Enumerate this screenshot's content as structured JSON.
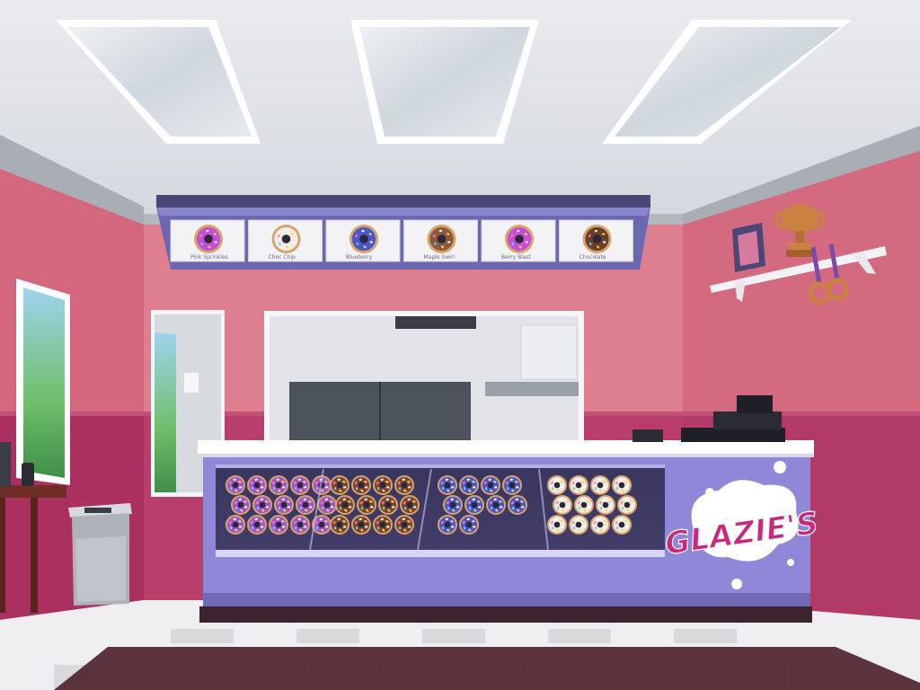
{
  "game": {
    "shop_name": "GLAZIE'S",
    "menu_board": {
      "items": [
        {
          "icon": "donut-pink-sprinkles-icon",
          "caption": "Pink Sprinkles",
          "frosting": "#c44fd6",
          "sprinkles": true
        },
        {
          "icon": "donut-chocolate-chip-icon",
          "caption": "Choc Chip",
          "frosting": "#f1ede6",
          "sprinkles": true
        },
        {
          "icon": "donut-blueberry-icon",
          "caption": "Blueberry",
          "frosting": "#4a56c9",
          "sprinkles": true
        },
        {
          "icon": "donut-maple-icon",
          "caption": "Maple Swirl",
          "frosting": "#8b5a3e",
          "sprinkles": true
        },
        {
          "icon": "donut-berry-icon",
          "caption": "Berry Blast",
          "frosting": "#c44fd6",
          "sprinkles": true
        },
        {
          "icon": "donut-chocolate-icon",
          "caption": "Chocolate",
          "frosting": "#6b3e2a",
          "sprinkles": true
        }
      ]
    },
    "display_case": {
      "sections": [
        {
          "name": "purple-glazed",
          "frosting": "#9e55cc",
          "count": 15
        },
        {
          "name": "chocolate-drizzle",
          "frosting": "#7a4630",
          "count": 12
        },
        {
          "name": "blue-glazed",
          "frosting": "#4b57c9",
          "count": 10
        },
        {
          "name": "white-chocolate-chip",
          "frosting": "#eeeae4",
          "count": 12
        }
      ]
    },
    "shelf_items": [
      "trophy-icon",
      "photo-frame-icon",
      "medal-icon",
      "medal-icon"
    ],
    "colors": {
      "wall_top": "#de7f8f",
      "wall_bottom": "#b93e6b",
      "counter": "#8f88d8",
      "ceiling": "#dfe3e8",
      "brand": "#c9297d"
    }
  }
}
